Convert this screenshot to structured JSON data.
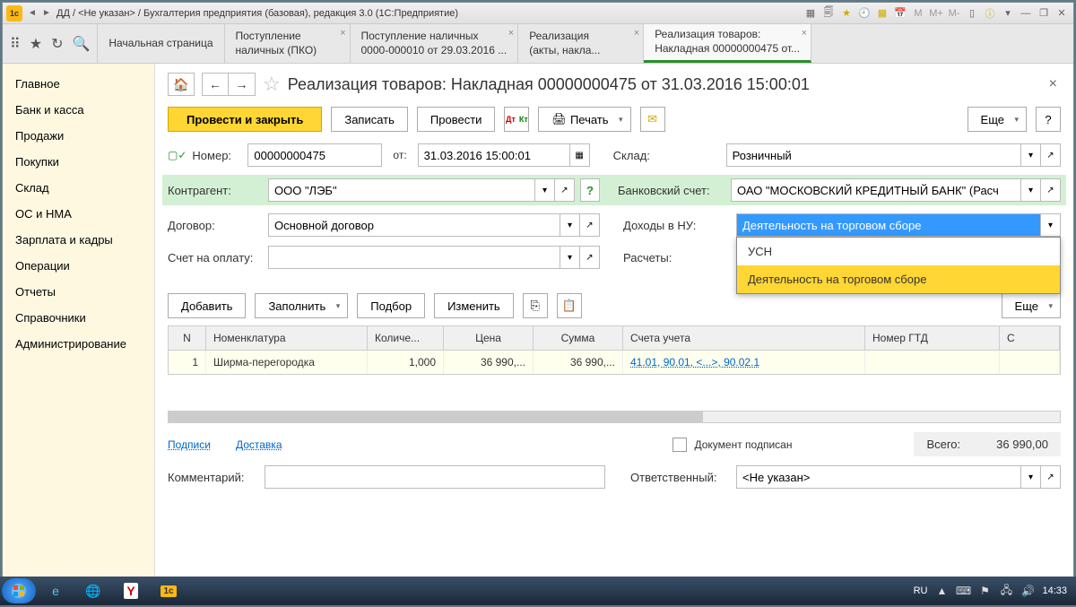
{
  "titlebar": {
    "title": "ДД / <Не указан> / Бухгалтерия предприятия (базовая), редакция 3.0  (1С:Предприятие)"
  },
  "tabs": [
    {
      "label": "Начальная страница"
    },
    {
      "label": "Поступление\nналичных (ПКО)"
    },
    {
      "label": "Поступление наличных\n0000-000010 от 29.03.2016 ..."
    },
    {
      "label": "Реализация\n(акты, накла..."
    },
    {
      "label": "Реализация товаров:\nНакладная 00000000475 от..."
    }
  ],
  "sidebar": {
    "items": [
      "Главное",
      "Банк и касса",
      "Продажи",
      "Покупки",
      "Склад",
      "ОС и НМА",
      "Зарплата и кадры",
      "Операции",
      "Отчеты",
      "Справочники",
      "Администрирование"
    ]
  },
  "doc": {
    "title": "Реализация товаров: Накладная 00000000475 от 31.03.2016 15:00:01",
    "toolbar": {
      "save_close": "Провести и закрыть",
      "write": "Записать",
      "post": "Провести",
      "print": "Печать",
      "more": "Еще"
    },
    "labels": {
      "number": "Номер:",
      "from": "от:",
      "warehouse": "Склад:",
      "contractor": "Контрагент:",
      "bank_account": "Банковский счет:",
      "contract": "Договор:",
      "income_nu": "Доходы в НУ:",
      "invoice": "Счет на оплату:",
      "calculations": "Расчеты:"
    },
    "values": {
      "number": "00000000475",
      "date": "31.03.2016 15:00:01",
      "warehouse": "Розничный",
      "contractor": "ООО \"ЛЭБ\"",
      "bank_account": "ОАО \"МОСКОВСКИЙ КРЕДИТНЫЙ БАНК\" (Расч",
      "contract": "Основной договор",
      "income_nu": "Деятельность на торговом сборе",
      "invoice": ""
    },
    "income_options": [
      "УСН",
      "Деятельность на торговом сборе"
    ]
  },
  "table": {
    "toolbar": {
      "add": "Добавить",
      "fill": "Заполнить",
      "select": "Подбор",
      "change": "Изменить",
      "more": "Еще"
    },
    "headers": [
      "N",
      "Номенклатура",
      "Количе...",
      "Цена",
      "Сумма",
      "Счета учета",
      "Номер ГТД",
      "С"
    ],
    "rows": [
      {
        "n": "1",
        "name": "Ширма-перегородка",
        "qty": "1,000",
        "price": "36 990,...",
        "sum": "36 990,...",
        "accounts": "41.01, 90.01, <...>, 90.02.1",
        "gtd": ""
      }
    ]
  },
  "footer": {
    "signatures": "Подписи",
    "delivery": "Доставка",
    "signed_label": "Документ подписан",
    "total_label": "Всего:",
    "total_value": "36 990,00",
    "comment_label": "Комментарий:",
    "responsible_label": "Ответственный:",
    "responsible_value": "<Не указан>"
  },
  "taskbar": {
    "lang": "RU",
    "time": "14:33"
  }
}
